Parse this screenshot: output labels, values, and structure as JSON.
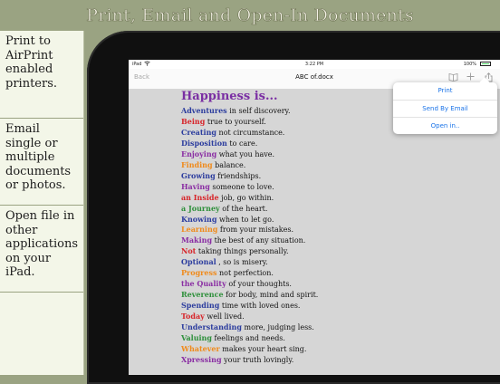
{
  "banner": {
    "title": "Print, Email and Open-In Documents"
  },
  "sidebar": {
    "items": [
      {
        "label": "Print to AirPrint enabled printers."
      },
      {
        "label": "Email single or multiple documents or photos."
      },
      {
        "label": "Open file in other applications on your iPad."
      }
    ]
  },
  "status_bar": {
    "carrier": "iPad",
    "time": "3:22 PM",
    "battery": "100%"
  },
  "nav": {
    "back": "Back",
    "title": "ABC of.docx"
  },
  "icons": {
    "book": "book-icon",
    "add": "plus-icon",
    "share": "share-icon"
  },
  "popover": {
    "print": "Print",
    "send_email": "Send By Email",
    "open_in": "Open in.."
  },
  "document": {
    "heading": "Happiness is...",
    "lines": [
      {
        "word": "Adventures",
        "rest": " in self discovery.",
        "color": "#2c3d9e"
      },
      {
        "word": "Being",
        "rest": " true to yourself.",
        "color": "#d7252a"
      },
      {
        "word": "Creating",
        "rest": " not circumstance.",
        "color": "#2c3d9e"
      },
      {
        "word": "Disposition",
        "rest": " to care.",
        "color": "#2c3d9e"
      },
      {
        "word": "Enjoying",
        "rest": " what you have.",
        "color": "#8a2ea3"
      },
      {
        "word": "Finding",
        "rest": " balance.",
        "color": "#f08a1a"
      },
      {
        "word": "Growing",
        "rest": " friendships.",
        "color": "#2c3d9e"
      },
      {
        "word": "Having",
        "rest": " someone to love.",
        "color": "#8a2ea3"
      },
      {
        "word": "an Inside",
        "rest": " job, go within.",
        "color": "#d7252a"
      },
      {
        "word": "a Journey",
        "rest": " of the heart.",
        "color": "#2d8f3a"
      },
      {
        "word": "Knowing",
        "rest": " when to let go.",
        "color": "#2c3d9e"
      },
      {
        "word": "Learning",
        "rest": " from your mistakes.",
        "color": "#f08a1a"
      },
      {
        "word": "Making",
        "rest": " the best of any situation.",
        "color": "#8a2ea3"
      },
      {
        "word": "Not",
        "rest": " taking things personally.",
        "color": "#d7252a"
      },
      {
        "word": "Optional",
        "rest": " , so is misery.",
        "color": "#2c3d9e"
      },
      {
        "word": "Progress",
        "rest": " not perfection.",
        "color": "#f08a1a"
      },
      {
        "word": "the Quality",
        "rest": " of your thoughts.",
        "color": "#8a2ea3"
      },
      {
        "word": "Reverence",
        "rest": " for body, mind and spirit.",
        "color": "#2d8f3a"
      },
      {
        "word": "Spending",
        "rest": " time with loved ones.",
        "color": "#2c3d9e"
      },
      {
        "word": "Today",
        "rest": " well lived.",
        "color": "#d7252a"
      },
      {
        "word": "Understanding",
        "rest": " more, judging less.",
        "color": "#2c3d9e"
      },
      {
        "word": "Valuing",
        "rest": " feelings and needs.",
        "color": "#2d8f3a"
      },
      {
        "word": "Whatever",
        "rest": " makes your heart sing.",
        "color": "#f08a1a"
      },
      {
        "word": "Xpressing",
        "rest": " your truth lovingly.",
        "color": "#8a2ea3"
      }
    ]
  }
}
